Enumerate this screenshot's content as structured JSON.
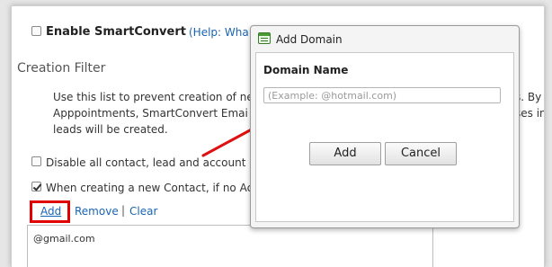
{
  "enable_smartconvert": {
    "label": "Enable SmartConvert",
    "help_link": "(Help: Wha"
  },
  "creation_filter": {
    "title": "Creation Filter",
    "description_lines": [
      "Use this list to prevent creation of ne",
      "Apppointments, SmartConvert Emai",
      "leads will be created."
    ],
    "description_right_fragments": [
      "s. By",
      "ses in"
    ],
    "options": [
      {
        "label": "Disable all contact, lead and account c",
        "checked": false
      },
      {
        "label": "When creating a new Contact, if no Ac",
        "checked": true
      }
    ],
    "actions": {
      "add": "Add",
      "separator1": "|",
      "remove": "Remove",
      "separator2": "|",
      "clear": "Clear"
    },
    "domains": [
      "@gmail.com"
    ]
  },
  "dialog": {
    "title": "Add Domain",
    "field_label": "Domain Name",
    "input_value": "",
    "input_placeholder": "(Example: @hotmail.com)",
    "add_button": "Add",
    "cancel_button": "Cancel"
  },
  "colors": {
    "link": "#1a64b4",
    "highlight": "#e00000",
    "arrow": "#dd1111"
  },
  "icons": {
    "dialog": "window-icon",
    "arrow": "red-arrow-annotation"
  }
}
